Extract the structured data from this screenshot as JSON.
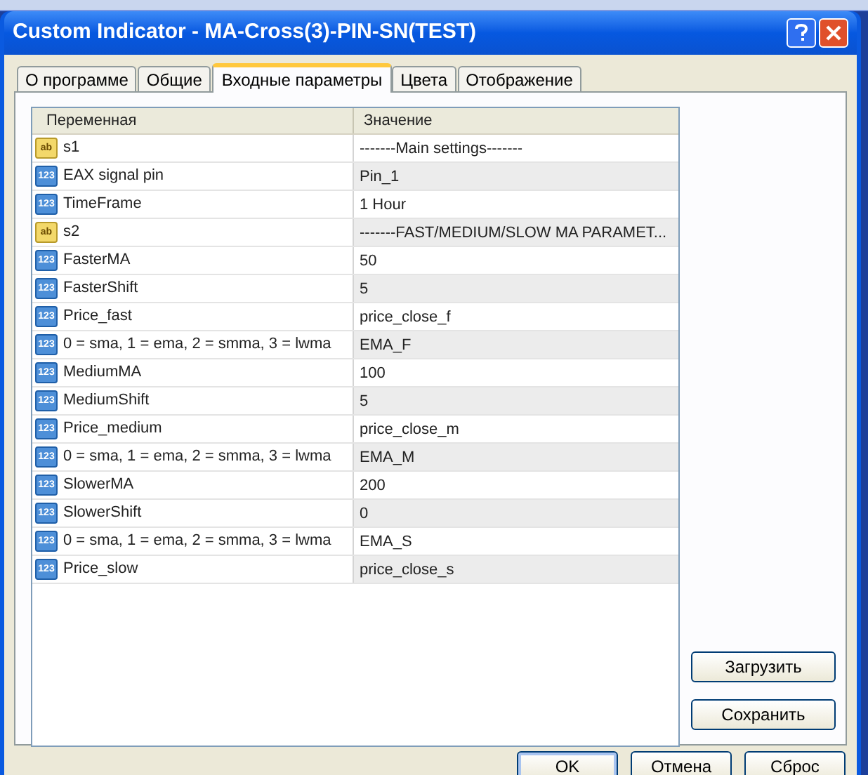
{
  "window": {
    "title": "Custom Indicator - MA-Cross(3)-PIN-SN(TEST)"
  },
  "tabs": [
    {
      "label": "О программе",
      "selected": false
    },
    {
      "label": "Общие",
      "selected": false
    },
    {
      "label": "Входные параметры",
      "selected": true
    },
    {
      "label": "Цвета",
      "selected": false
    },
    {
      "label": "Отображение",
      "selected": false
    }
  ],
  "table": {
    "columns": [
      "Переменная",
      "Значение"
    ],
    "rows": [
      {
        "kind": "string",
        "badge": "ab",
        "name": "s1",
        "value": "-------Main settings-------"
      },
      {
        "kind": "number",
        "badge": "123",
        "name": "EAX signal pin",
        "value": "Pin_1"
      },
      {
        "kind": "number",
        "badge": "123",
        "name": "TimeFrame",
        "value": "1 Hour"
      },
      {
        "kind": "string",
        "badge": "ab",
        "name": "s2",
        "value": "-------FAST/MEDIUM/SLOW MA PARAMET..."
      },
      {
        "kind": "number",
        "badge": "123",
        "name": "FasterMA",
        "value": "50"
      },
      {
        "kind": "number",
        "badge": "123",
        "name": "FasterShift",
        "value": "5"
      },
      {
        "kind": "number",
        "badge": "123",
        "name": "Price_fast",
        "value": "price_close_f"
      },
      {
        "kind": "number",
        "badge": "123",
        "name": "0 = sma, 1 = ema, 2 = smma, 3 = lwma",
        "value": "EMA_F"
      },
      {
        "kind": "number",
        "badge": "123",
        "name": "MediumMA",
        "value": "100"
      },
      {
        "kind": "number",
        "badge": "123",
        "name": "MediumShift",
        "value": "5"
      },
      {
        "kind": "number",
        "badge": "123",
        "name": "Price_medium",
        "value": "price_close_m"
      },
      {
        "kind": "number",
        "badge": "123",
        "name": "0 = sma, 1 = ema, 2 = smma, 3 = lwma",
        "value": "EMA_M"
      },
      {
        "kind": "number",
        "badge": "123",
        "name": "SlowerMA",
        "value": "200"
      },
      {
        "kind": "number",
        "badge": "123",
        "name": "SlowerShift",
        "value": "0"
      },
      {
        "kind": "number",
        "badge": "123",
        "name": "0 = sma, 1 = ema, 2 = smma, 3 = lwma",
        "value": "EMA_S"
      },
      {
        "kind": "number",
        "badge": "123",
        "name": "Price_slow",
        "value": "price_close_s"
      }
    ]
  },
  "side_buttons": [
    "Загрузить",
    "Сохранить"
  ],
  "buttons": [
    "OK",
    "Отмена",
    "Сброс"
  ]
}
